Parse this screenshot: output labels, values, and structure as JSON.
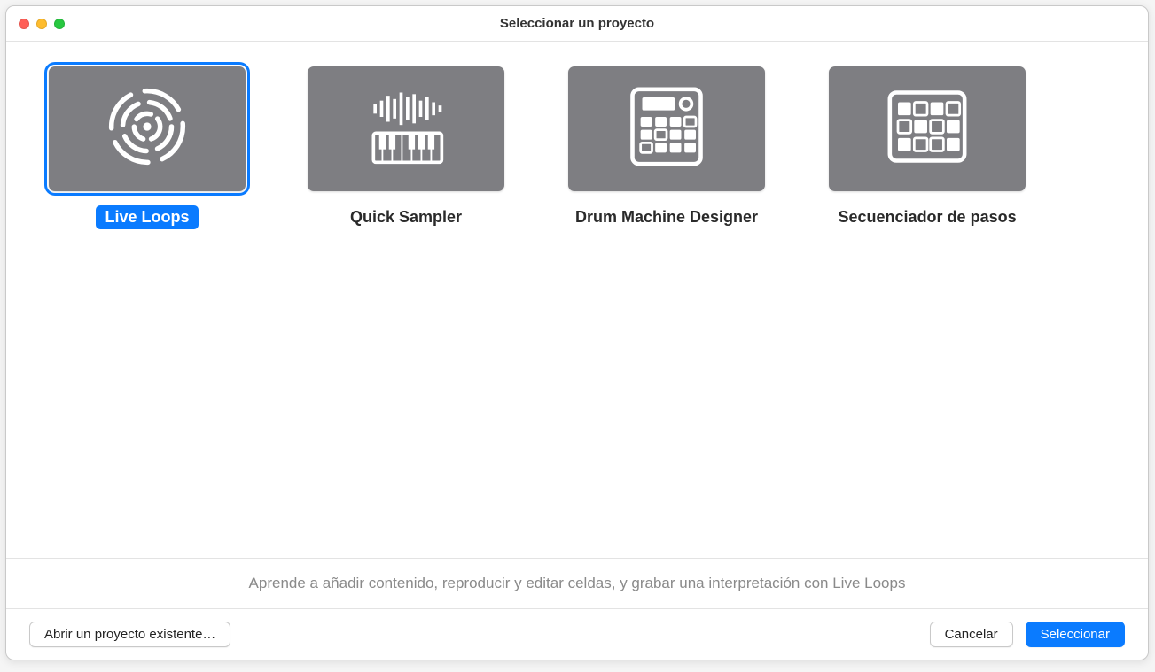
{
  "window": {
    "title": "Seleccionar un proyecto"
  },
  "templates": [
    {
      "label": "Live Loops",
      "icon": "live-loops-icon",
      "selected": true
    },
    {
      "label": "Quick Sampler",
      "icon": "quick-sampler-icon",
      "selected": false
    },
    {
      "label": "Drum Machine Designer",
      "icon": "drum-machine-icon",
      "selected": false
    },
    {
      "label": "Secuenciador de pasos",
      "icon": "step-sequencer-icon",
      "selected": false
    }
  ],
  "description": "Aprende a añadir contenido, reproducir y editar celdas, y grabar una interpretación con Live Loops",
  "footer": {
    "open_existing": "Abrir un proyecto existente…",
    "cancel": "Cancelar",
    "select": "Seleccionar"
  }
}
